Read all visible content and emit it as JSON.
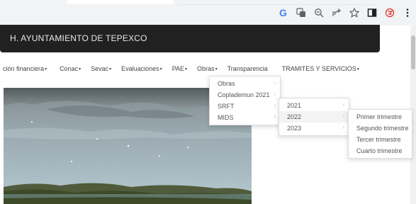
{
  "browser": {
    "icons": [
      "google-icon",
      "translate-icon",
      "zoom-icon",
      "share-icon",
      "bookmark-star-icon",
      "sidepanel-icon",
      "extension-icon",
      "menu-dots-icon"
    ],
    "google_letter": "G"
  },
  "site": {
    "title": "H. AYUNTAMIENTO DE TEPEXCO"
  },
  "nav": {
    "items": [
      {
        "label": "ción financiera",
        "has_caret": true
      },
      {
        "label": "Conac",
        "has_caret": true
      },
      {
        "label": "Sevac",
        "has_caret": true
      },
      {
        "label": "Evaluaciones",
        "has_caret": true
      },
      {
        "label": "PAE",
        "has_caret": true
      },
      {
        "label": "Obras",
        "has_caret": true
      },
      {
        "label": "Transparencia",
        "has_caret": false
      },
      {
        "label": "TRAMITES Y SERVICIOS",
        "has_caret": true
      }
    ],
    "caret": "▾"
  },
  "menus": {
    "obras": [
      "Obras",
      "Coplademun 2021",
      "SRFT",
      "MIDS"
    ],
    "srft": [
      "2021",
      "2022",
      "2023"
    ],
    "year_2022": [
      "Primer trimestre",
      "Segundo trimestre",
      "Tercer trimestre",
      "Cuarto trimestre"
    ],
    "arrow": "›"
  },
  "colors": {
    "header_bg": "#212121",
    "header_text": "#e8e8e8",
    "menu_hover": "#f3f3f3"
  }
}
